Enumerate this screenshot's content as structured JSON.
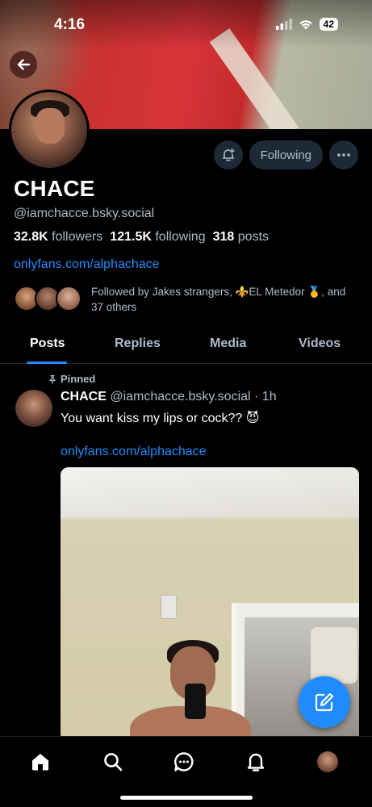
{
  "status_bar": {
    "time": "4:16",
    "battery": "42"
  },
  "profile": {
    "display_name": "CHACE",
    "handle": "@iamchacce.bsky.social",
    "followers_count": "32.8K",
    "followers_label": "followers",
    "following_count": "121.5K",
    "following_label": "following",
    "posts_count": "318",
    "posts_label": "posts",
    "link": "onlyfans.com/alphachace",
    "follow_button_label": "Following",
    "followed_by": "Followed by Jakes strangers, ⚜️EL Metedor 🥇, and 37 others"
  },
  "tabs": [
    "Posts",
    "Replies",
    "Media",
    "Videos"
  ],
  "active_tab": "Posts",
  "post": {
    "pinned_label": "Pinned",
    "author": "CHACE",
    "handle": "@iamchacce.bsky.social",
    "time": "· 1h",
    "text": "You want kiss my lips or cock?? 😈",
    "link": "onlyfans.com/alphachace"
  },
  "icons": {
    "back": "arrow-left-icon",
    "bell": "bell-plus-icon",
    "more": "ellipsis-icon",
    "pin": "pin-icon",
    "compose": "compose-icon",
    "nav": [
      "home-icon",
      "search-icon",
      "chat-icon",
      "bell-icon",
      "avatar"
    ]
  },
  "colors": {
    "accent": "#208bfe",
    "muted": "#aebbc9",
    "button_bg": "#1e2937",
    "background": "#000000"
  }
}
